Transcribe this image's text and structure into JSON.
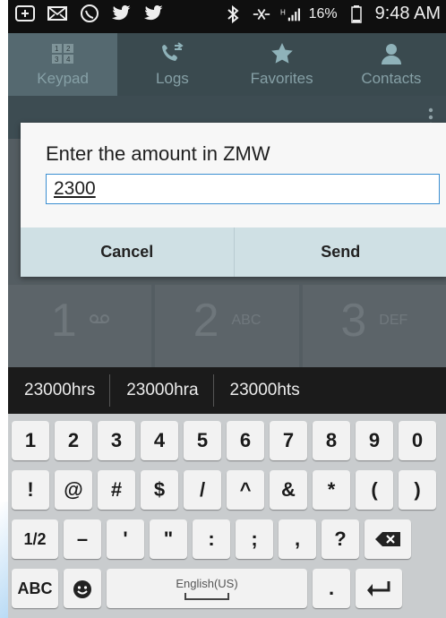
{
  "status_bar": {
    "battery": "16%",
    "time": "9:48 AM"
  },
  "tabs": [
    {
      "label": "Keypad",
      "active": true
    },
    {
      "label": "Logs",
      "active": false
    },
    {
      "label": "Favorites",
      "active": false
    },
    {
      "label": "Contacts",
      "active": false
    }
  ],
  "dialpad": {
    "keys": [
      {
        "num": "1",
        "sub": "voicemail-icon"
      },
      {
        "num": "2",
        "sub": "ABC"
      },
      {
        "num": "3",
        "sub": "DEF"
      }
    ]
  },
  "dialog": {
    "prompt": "Enter the amount in  ZMW",
    "input_value": "2300",
    "cancel_label": "Cancel",
    "send_label": "Send"
  },
  "suggestions": [
    "23000hrs",
    "23000hra",
    "23000hts"
  ],
  "keyboard": {
    "row1": [
      "1",
      "2",
      "3",
      "4",
      "5",
      "6",
      "7",
      "8",
      "9",
      "0"
    ],
    "row2": [
      "!",
      "@",
      "#",
      "$",
      "/",
      "^",
      "&",
      "*",
      "(",
      ")"
    ],
    "row3": [
      "1/2",
      "–",
      "'",
      "\"",
      ":",
      ";",
      ",",
      "?",
      "backspace-icon"
    ],
    "row4": {
      "abc": "ABC",
      "emoji": "emoji-icon",
      "space_label": "English(US)",
      "period": ".",
      "enter": "enter-icon"
    }
  },
  "colors": {
    "accent_blue": "#3b8fd1",
    "dialog_button_bg": "#cfe0e4"
  }
}
